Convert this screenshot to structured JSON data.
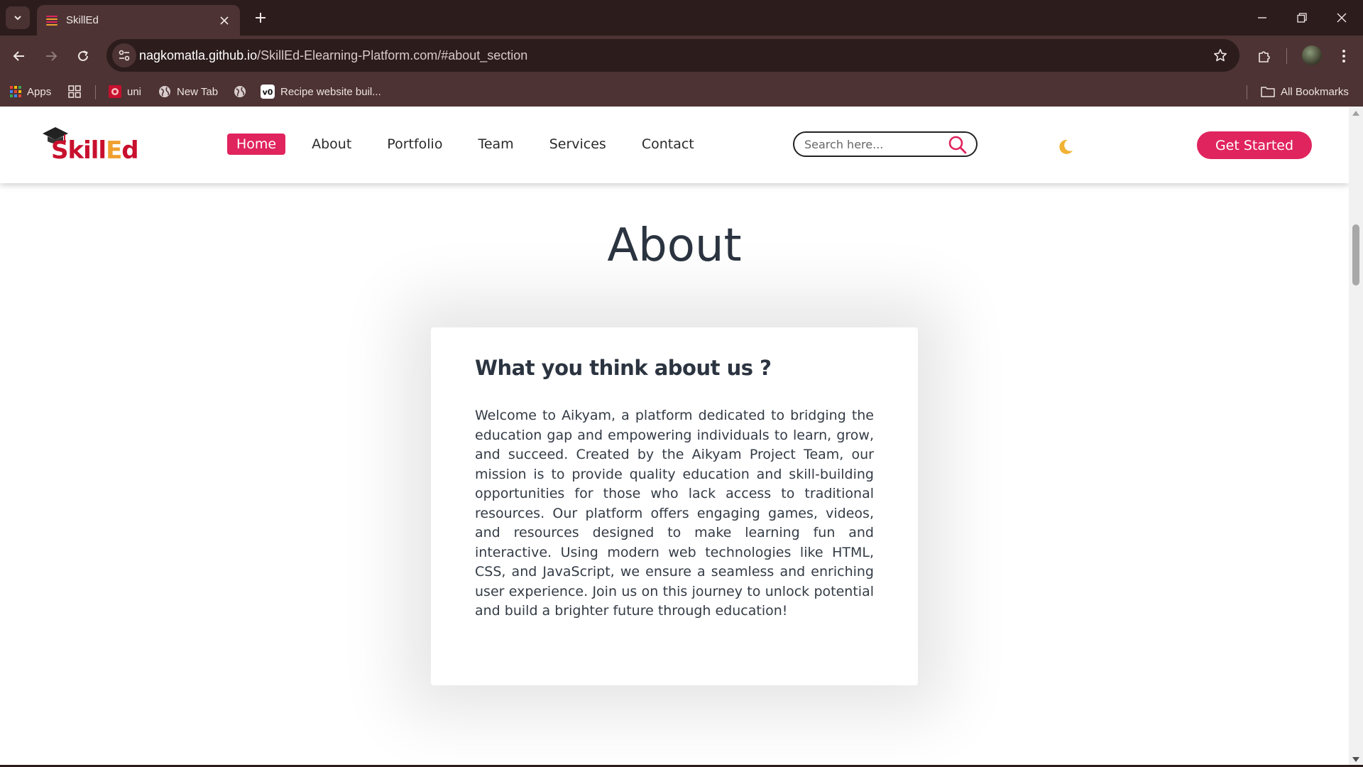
{
  "browser": {
    "tab": {
      "title": "SkillEd"
    },
    "address": {
      "host": "nagkomatla.github.io",
      "path": "/SkillEd-Elearning-Platform.com/#about_section"
    },
    "bookmarks": [
      {
        "label": "Apps",
        "icon": "apps-grid-icon"
      },
      {
        "label": "",
        "icon": "tab-groups-icon"
      },
      {
        "label": "uni",
        "icon": "uni-favicon-icon"
      },
      {
        "label": "New Tab",
        "icon": "globe-icon"
      },
      {
        "label": "",
        "icon": "globe-icon"
      },
      {
        "label": "Recipe website buil...",
        "icon": "vo-favicon-icon"
      }
    ],
    "all_bookmarks_label": "All Bookmarks"
  },
  "site": {
    "logo_text": "SkillEd",
    "nav": [
      {
        "label": "Home",
        "active": true
      },
      {
        "label": "About"
      },
      {
        "label": "Portfolio"
      },
      {
        "label": "Team"
      },
      {
        "label": "Services"
      },
      {
        "label": "Contact"
      }
    ],
    "search_placeholder": "Search here...",
    "theme_toggle_icon": "moon-icon",
    "cta_label": "Get Started",
    "accent_color": "#e0245e"
  },
  "about": {
    "heading": "About",
    "card_title": "What you think about us ?",
    "card_body": "Welcome to Aikyam, a platform dedicated to bridging the education gap and empowering individuals to learn, grow, and succeed. Created by the Aikyam Project Team, our mission is to provide quality education and skill-building opportunities for those who lack access to traditional resources. Our platform offers engaging games, videos, and resources designed to make learning fun and interactive. Using modern web technologies like HTML, CSS, and JavaScript, we ensure a seamless and enriching user experience. Join us on this journey to unlock potential and build a brighter future through education!"
  }
}
